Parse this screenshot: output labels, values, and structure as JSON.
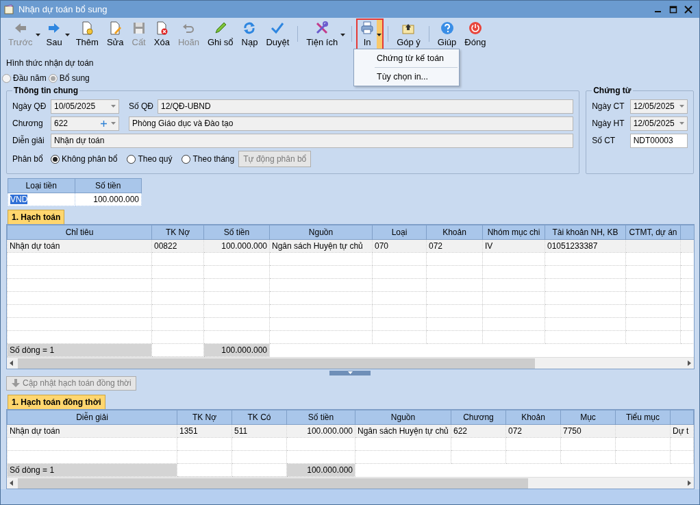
{
  "window": {
    "title": "Nhận dự toán bổ sung"
  },
  "toolbar": [
    {
      "kind": "button",
      "label": "Trước",
      "disabled": true,
      "dropdown": true,
      "highlighted": false
    },
    {
      "kind": "button",
      "label": "Sau",
      "disabled": false,
      "dropdown": true,
      "highlighted": false
    },
    {
      "kind": "button",
      "label": "Thêm",
      "disabled": false,
      "dropdown": false,
      "highlighted": false
    },
    {
      "kind": "button",
      "label": "Sửa",
      "disabled": false,
      "dropdown": false,
      "highlighted": false
    },
    {
      "kind": "button",
      "label": "Cất",
      "disabled": true,
      "dropdown": false,
      "highlighted": false
    },
    {
      "kind": "button",
      "label": "Xóa",
      "disabled": false,
      "dropdown": false,
      "highlighted": false
    },
    {
      "kind": "button",
      "label": "Hoãn",
      "disabled": true,
      "dropdown": false,
      "highlighted": false
    },
    {
      "kind": "button",
      "label": "Ghi sổ",
      "disabled": false,
      "dropdown": false,
      "highlighted": false
    },
    {
      "kind": "button",
      "label": "Nạp",
      "disabled": false,
      "dropdown": false,
      "highlighted": false
    },
    {
      "kind": "button",
      "label": "Duyệt",
      "disabled": false,
      "dropdown": false,
      "highlighted": false
    },
    {
      "kind": "separator"
    },
    {
      "kind": "button",
      "label": "Tiện ích",
      "disabled": false,
      "dropdown": true,
      "highlighted": false
    },
    {
      "kind": "separator"
    },
    {
      "kind": "button",
      "label": "In",
      "disabled": false,
      "dropdown": true,
      "highlighted": true
    },
    {
      "kind": "separator"
    },
    {
      "kind": "button",
      "label": "Góp ý",
      "disabled": false,
      "dropdown": false,
      "highlighted": false
    },
    {
      "kind": "separator"
    },
    {
      "kind": "button",
      "label": "Giúp",
      "disabled": false,
      "dropdown": false,
      "highlighted": false
    },
    {
      "kind": "button",
      "label": "Đóng",
      "disabled": false,
      "dropdown": false,
      "highlighted": false
    }
  ],
  "print_menu": {
    "open": true,
    "items": [
      "Chứng từ kế toán",
      "Tùy chọn in..."
    ]
  },
  "receive_type": {
    "label": "Hình thức nhận dự toán",
    "disabled": true,
    "options": [
      {
        "label": "Đầu năm",
        "selected": false
      },
      {
        "label": "Bổ sung",
        "selected": true
      }
    ]
  },
  "general": {
    "title": "Thông tin chung",
    "decision_date": {
      "label": "Ngày QĐ",
      "value": "10/05/2025"
    },
    "decision_no": {
      "label": "Số QĐ",
      "value": "12/QĐ-UBND"
    },
    "chapter": {
      "label": "Chương",
      "value": "622",
      "name": "Phòng Giáo dục và Đào tạo"
    },
    "description": {
      "label": "Diễn giải",
      "value": "Nhận dự toán"
    },
    "allocation": {
      "label": "Phân bổ",
      "options": [
        {
          "label": "Không phân bổ",
          "selected": true
        },
        {
          "label": "Theo quý",
          "selected": false
        },
        {
          "label": "Theo tháng",
          "selected": false
        }
      ],
      "auto_button": {
        "label": "Tự động phân bổ",
        "disabled": true
      }
    }
  },
  "voucher": {
    "title": "Chứng từ",
    "fields": [
      {
        "label": "Ngày CT",
        "value": "12/05/2025",
        "kind": "date"
      },
      {
        "label": "Ngày HT",
        "value": "12/05/2025",
        "kind": "date"
      },
      {
        "label": "Số CT",
        "value": "NDT00003",
        "kind": "text"
      }
    ]
  },
  "currency": {
    "columns": [
      "Loại tiền",
      "Số tiền"
    ],
    "cells": [
      "VND",
      "100.000.000"
    ],
    "text_selected": true
  },
  "grids": [
    {
      "tab": "1. Hạch toán",
      "columns": [
        "Chỉ tiêu",
        "TK Nợ",
        "Số tiền",
        "Nguồn",
        "Loại",
        "Khoản",
        "Nhóm mục chi",
        "Tài khoản NH, KB",
        "CTMT, dự án"
      ],
      "rows": [
        [
          "Nhận dự toán",
          "00822",
          "100.000.000",
          "Ngân sách Huyện tự chủ",
          "070",
          "072",
          "IV",
          "01051233387",
          null,
          null
        ]
      ],
      "footer": {
        "count": "Số dòng = 1",
        "total": "100.000.000"
      }
    },
    {
      "tab": "1. Hạch toán đồng thời",
      "columns": [
        "Diễn giải",
        "TK Nợ",
        "TK Có",
        "Số tiền",
        "Nguồn",
        "Chương",
        "Khoản",
        "Mục",
        "Tiểu mục"
      ],
      "rows": [
        [
          "Nhận dự toán",
          "1351",
          "511",
          "100.000.000",
          "Ngân sách Huyện tự chủ",
          "622",
          "072",
          "7750",
          null,
          "Dự t"
        ]
      ],
      "footer": {
        "count": "Số dòng = 1",
        "total": "100.000.000"
      }
    }
  ],
  "sync_button": {
    "label": "Cập nhật hạch toán đồng thời",
    "disabled": true
  }
}
